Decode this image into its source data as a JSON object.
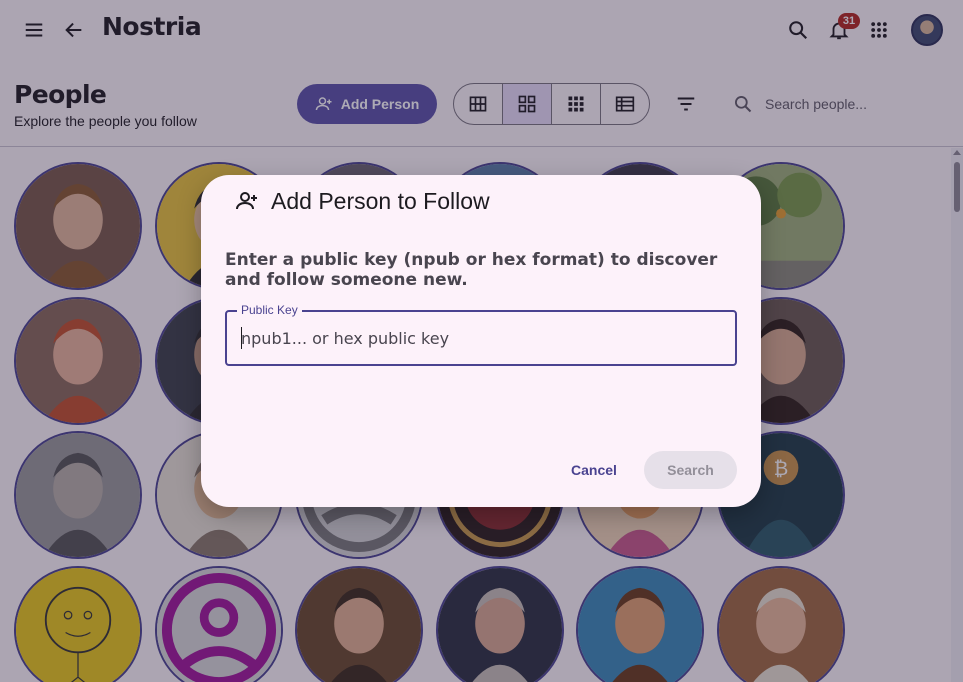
{
  "app": {
    "brand": "Nostria",
    "notification_count": "31",
    "icons": {
      "menu": "menu-icon",
      "back": "arrow-back-icon",
      "search": "search-icon",
      "notifications": "bell-icon",
      "apps": "apps-grid-icon"
    }
  },
  "page": {
    "title": "People",
    "subtitle": "Explore the people you follow",
    "add_button_label": "Add Person",
    "view_modes": [
      "large-grid",
      "medium-grid",
      "small-grid",
      "list"
    ],
    "active_view": "medium-grid",
    "search_placeholder": "Search people..."
  },
  "people": [
    {
      "row": 0,
      "col": 0,
      "kind": "portrait",
      "bg": "#7a5a4a",
      "skin": "#e2b69a",
      "hair": "#8a5a2e"
    },
    {
      "row": 0,
      "col": 1,
      "kind": "comic",
      "bg": "#e8c43a",
      "skin": "#f0c9a0",
      "hair": "#2b2b2b"
    },
    {
      "row": 0,
      "col": 2,
      "kind": "dark",
      "bg": "#6b6570",
      "skin": "#b89484",
      "hair": "#3b2f2a"
    },
    {
      "row": 0,
      "col": 3,
      "kind": "sky",
      "bg": "#5a7fa6",
      "skin": "#c9b8a8",
      "hair": "#40506a"
    },
    {
      "row": 0,
      "col": 4,
      "kind": "dark",
      "bg": "#3e3a4a",
      "skin": "#a88070",
      "hair": "#2a2222"
    },
    {
      "row": 0,
      "col": 5,
      "kind": "tree",
      "bg": "#9fb07a",
      "skin": "#e07030",
      "hair": "#5a7a3a"
    },
    {
      "row": 1,
      "col": 0,
      "kind": "portrait",
      "bg": "#8a6a5a",
      "skin": "#e8b49a",
      "hair": "#c2502a"
    },
    {
      "row": 1,
      "col": 1,
      "kind": "portrait",
      "bg": "#3a4048",
      "skin": "#c29a80",
      "hair": "#2e2e2e"
    },
    {
      "row": 1,
      "col": 5,
      "kind": "portrait",
      "bg": "#6a5a50",
      "skin": "#d8ab8e",
      "hair": "#2e2018"
    },
    {
      "row": 2,
      "col": 0,
      "kind": "portrait",
      "bg": "#9a9a9a",
      "skin": "#b8b0a8",
      "hair": "#555555"
    },
    {
      "row": 2,
      "col": 1,
      "kind": "sketch",
      "bg": "#e9e2d6",
      "skin": "#e0b890",
      "hair": "#8a7a6a"
    },
    {
      "row": 2,
      "col": 2,
      "kind": "generic",
      "bg": "#d6d6d6",
      "skin": "#7a7a7a",
      "hair": "#7a7a7a"
    },
    {
      "row": 2,
      "col": 3,
      "kind": "seal",
      "bg": "#2a1e1a",
      "skin": "#c89a4a",
      "hair": "#8a2a2a"
    },
    {
      "row": 2,
      "col": 4,
      "kind": "comic",
      "bg": "#f0d6b6",
      "skin": "#e8a060",
      "hair": "#c85a8a"
    },
    {
      "row": 2,
      "col": 5,
      "kind": "bitcoin",
      "bg": "#1e3a44",
      "skin": "#c9944a",
      "hair": "#2a5a66"
    },
    {
      "row": 3,
      "col": 0,
      "kind": "smiley",
      "bg": "#e8c81a",
      "skin": "#e8c81a",
      "hair": "#333333"
    },
    {
      "row": 3,
      "col": 1,
      "kind": "ring",
      "bg": "#d8d8d8",
      "skin": "#a0169a",
      "hair": "#a0169a"
    },
    {
      "row": 3,
      "col": 2,
      "kind": "portrait",
      "bg": "#6a4a2a",
      "skin": "#e2b090",
      "hair": "#3a2a1a"
    },
    {
      "row": 3,
      "col": 3,
      "kind": "beard",
      "bg": "#2a3040",
      "skin": "#d8a890",
      "hair": "#c8c0b8"
    },
    {
      "row": 3,
      "col": 4,
      "kind": "art",
      "bg": "#3a8ab8",
      "skin": "#e0a070",
      "hair": "#6a3a1a"
    },
    {
      "row": 3,
      "col": 5,
      "kind": "portrait",
      "bg": "#a06a40",
      "skin": "#e8b898",
      "hair": "#e8e0d0"
    }
  ],
  "dialog": {
    "title": "Add Person to Follow",
    "description": "Enter a public key (npub or hex format) to discover and follow someone new.",
    "field_label": "Public Key",
    "field_placeholder": "npub1... or hex public key",
    "field_value": "",
    "cancel_label": "Cancel",
    "search_label": "Search"
  }
}
